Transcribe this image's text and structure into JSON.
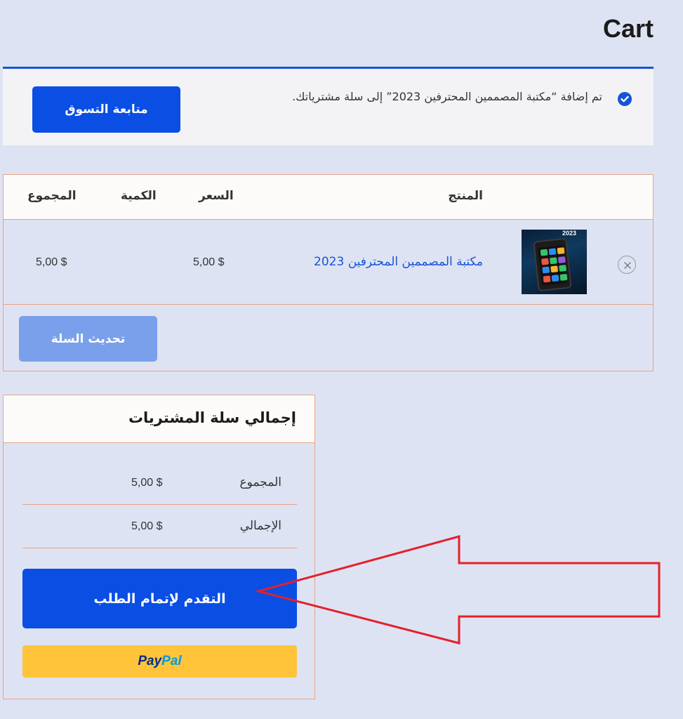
{
  "page": {
    "title": "Cart"
  },
  "notice": {
    "message": "تم إضافة “مكتبة المصممين المحترفين 2023” إلى سلة مشترياتك.",
    "continue_label": "متابعة التسوق",
    "icon": "check-circle-icon"
  },
  "cart": {
    "headers": {
      "product": "المنتج",
      "price": "السعر",
      "quantity": "الكمية",
      "subtotal": "المجموع"
    },
    "items": [
      {
        "name": "مكتبة المصممين المحترفين 2023",
        "price": "5,00 $",
        "subtotal": "5,00 $",
        "thumb_text": "2023"
      }
    ],
    "update_label": "تحديث السلة"
  },
  "totals": {
    "title": "إجمالي سلة المشتريات",
    "subtotal_label": "المجموع",
    "subtotal_value": "5,00 $",
    "total_label": "الإجمالي",
    "total_value": "5,00 $",
    "checkout_label": "التقدم لإتمام الطلب",
    "paypal_pay": "Pay",
    "paypal_pal": "Pal"
  },
  "colors": {
    "accent": "#0a4ee4",
    "border": "#e7a386",
    "background": "#dee3f3",
    "annotation_arrow": "#e5202a",
    "paypal": "#ffc439"
  }
}
